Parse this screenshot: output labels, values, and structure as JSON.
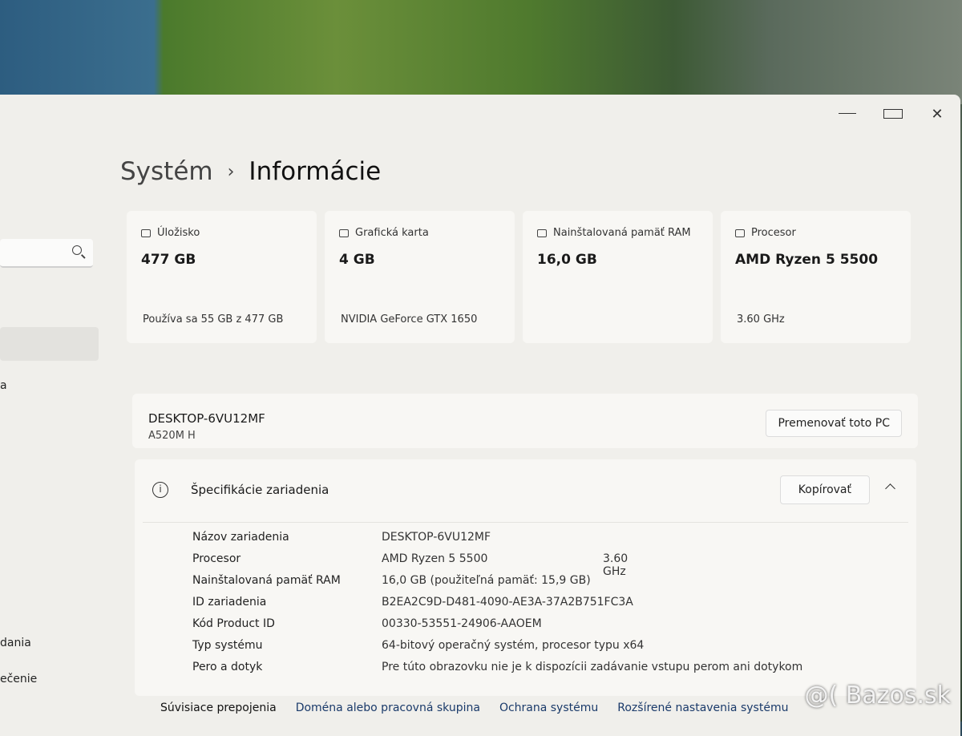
{
  "window": {
    "controls": {
      "minimize": "minimize-icon",
      "maximize": "maximize-icon",
      "close": "✕"
    }
  },
  "sidebar": {
    "items": [
      {
        "label": "a"
      },
      {
        "label": "dania"
      },
      {
        "label": "ečenie"
      }
    ]
  },
  "header": {
    "parent": "Systém",
    "separator": "›",
    "current": "Informácie"
  },
  "tiles": [
    {
      "icon": "storage-icon",
      "label": "Úložisko",
      "value": "477 GB",
      "sub": "Používa sa 55 GB z 477 GB"
    },
    {
      "icon": "gpu-icon",
      "label": "Grafická karta",
      "value": "4 GB",
      "sub": "NVIDIA GeForce GTX 1650"
    },
    {
      "icon": "ram-icon",
      "label": "Nainštalovaná pamäť RAM",
      "value": "16,0 GB",
      "sub": ""
    },
    {
      "icon": "processor-icon",
      "label": "Procesor",
      "value": "AMD Ryzen 5 5500",
      "sub": "3.60 GHz"
    }
  ],
  "device": {
    "name": "DESKTOP-6VU12MF",
    "model": "A520M H",
    "rename_label": "Premenovať toto PC"
  },
  "specs": {
    "title": "Špecifikácie zariadenia",
    "copy_label": "Kopírovať",
    "rows": [
      {
        "label": "Názov zariadenia",
        "value": "DESKTOP-6VU12MF",
        "extra": ""
      },
      {
        "label": "Procesor",
        "value": "AMD Ryzen 5 5500",
        "extra": "3.60 GHz"
      },
      {
        "label": "Nainštalovaná pamäť RAM",
        "value": "16,0 GB (použiteľná pamäť: 15,9 GB)",
        "extra": ""
      },
      {
        "label": "ID zariadenia",
        "value": "B2EA2C9D-D481-4090-AE3A-37A2B751FC3A",
        "extra": ""
      },
      {
        "label": "Kód Product ID",
        "value": "00330-53551-24906-AAOEM",
        "extra": ""
      },
      {
        "label": "Typ systému",
        "value": "64-bitový operačný systém, procesor typu x64",
        "extra": ""
      },
      {
        "label": "Pero a dotyk",
        "value": "Pre túto obrazovku nie je k dispozícii zadávanie vstupu perom ani dotykom",
        "extra": ""
      }
    ]
  },
  "related": {
    "title": "Súvisiace prepojenia",
    "links": [
      "Doména alebo pracovná skupina",
      "Ochrana systému",
      "Rozšírené nastavenia systému"
    ]
  },
  "watermark": "@( Bazos.sk"
}
